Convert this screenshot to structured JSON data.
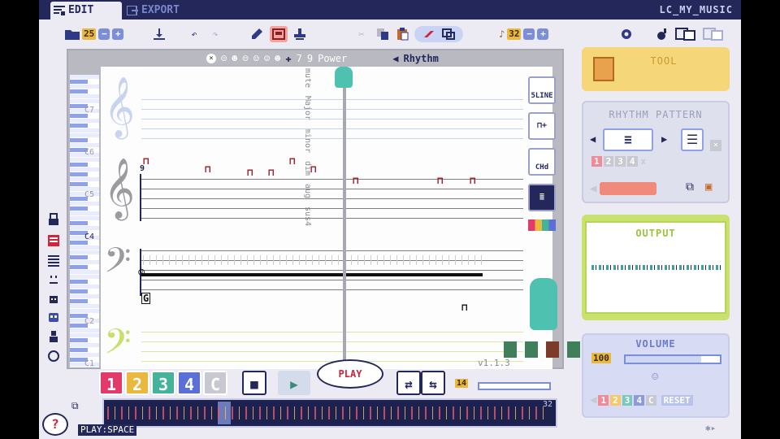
{
  "tabs": [
    {
      "label": "EDIT",
      "active": true
    },
    {
      "label": "EXPORT",
      "active": false
    }
  ],
  "song_name": "LC_MY_MUSIC",
  "toolbar": {
    "pattern_number": "25",
    "tempo_value": "32",
    "note_value_symbol": "♪"
  },
  "editor": {
    "power_label": "Power",
    "rhythm_label": "Rhythm",
    "chord_labels": [
      "mute",
      "Major",
      "minor",
      "dim",
      "aug",
      "sus4"
    ],
    "octave_labels": [
      "C7",
      "C6",
      "C5",
      "C4",
      "C3",
      "C2",
      "C1"
    ],
    "bar_number": "9",
    "side_buttons": {
      "line": "5LINE",
      "add": "",
      "chord": "CHd",
      "layers": "",
      "palette": ""
    },
    "bass_note": "G",
    "version": "v1.1.3"
  },
  "channels": {
    "items": [
      "1",
      "2",
      "3",
      "4",
      "C"
    ],
    "colors": [
      "#e23b6b",
      "#e9b83c",
      "#45b39a",
      "#5b6fd6",
      "#c8c8d0"
    ]
  },
  "playback": {
    "play_label": "PLAY",
    "loop_count": "14",
    "loop_max": "32",
    "shortcut_hint": "PLAY:SPACE"
  },
  "panels": {
    "tool": {
      "title": "TOOL"
    },
    "rhythm": {
      "title": "RHYTHM PATTERN",
      "slots": [
        "1",
        "2",
        "3",
        "4",
        "x"
      ]
    },
    "output": {
      "title": "OUTPUT"
    },
    "volume": {
      "title": "VOLUME",
      "value": "100",
      "channels": [
        "1",
        "2",
        "3",
        "4",
        "C"
      ],
      "reset_label": "RESET"
    }
  },
  "colors": {
    "navy": "#23275a",
    "accent": "#7b8fd8",
    "note_red": "#a01824",
    "gold": "#e9b83c"
  }
}
